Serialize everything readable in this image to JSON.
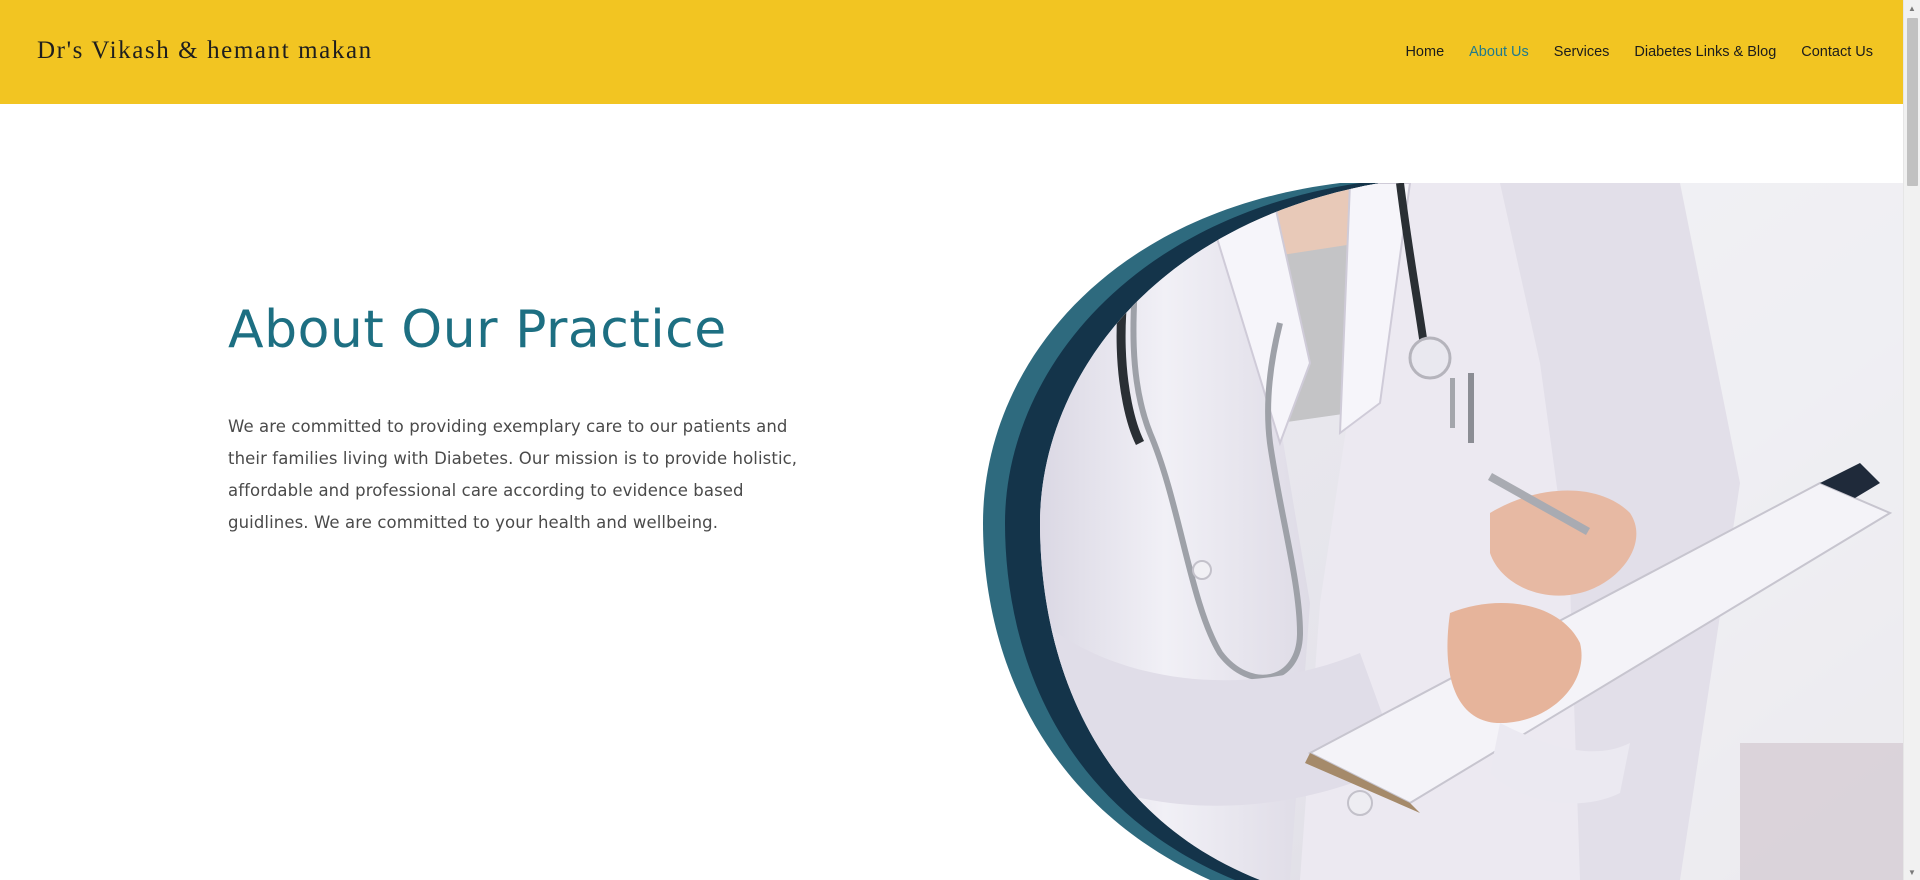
{
  "header": {
    "brand": "Dr's Vikash & hemant makan",
    "nav": [
      {
        "label": "Home",
        "active": false
      },
      {
        "label": "About Us",
        "active": true
      },
      {
        "label": "Services",
        "active": false
      },
      {
        "label": "Diabetes  Links & Blog",
        "active": false
      },
      {
        "label": "Contact Us",
        "active": false
      }
    ]
  },
  "hero": {
    "title": "About Our Practice",
    "text": "We are committed to providing exemplary care to our patients and their families living with Diabetes. Our mission is to provide holistic, affordable and professional care according to evidence based guidlines. We are committed to your health and wellbeing."
  },
  "colors": {
    "header_bg": "#f2c522",
    "accent": "#1d6f82",
    "nav_active": "#217a8c",
    "arc_outer": "#2e6a7e",
    "arc_inner": "#14344a"
  },
  "icons": {
    "scroll_up": "▲",
    "scroll_down": "▼"
  }
}
